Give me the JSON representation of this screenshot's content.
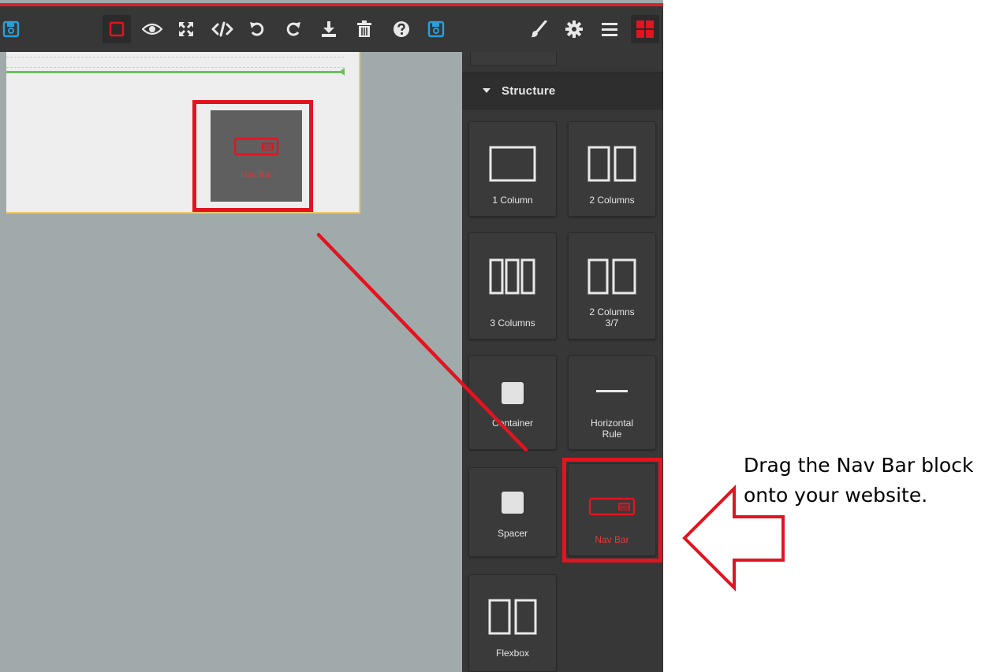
{
  "colors": {
    "canvas_bg": "#a1aaab",
    "toolbar_bg": "#373737",
    "panel_bg": "#373737",
    "accent_red": "#e2141f",
    "icon_blue": "#2a9fd8",
    "icon_white": "#e8e8e8",
    "green_line": "#6bbf5b"
  },
  "toolbar": {
    "left_icon": "save-icon",
    "icons": [
      "square-outline-icon",
      "eye-icon",
      "fullscreen-icon",
      "code-icon",
      "undo-icon",
      "redo-icon",
      "download-icon",
      "trash-icon",
      "help-icon",
      "save-icon"
    ],
    "right_icons": [
      "paintbrush-icon",
      "gear-icon",
      "menu-icon",
      "blocks-icon"
    ]
  },
  "drag_preview": {
    "label": "Nav Bar"
  },
  "panel": {
    "section_title": "Structure",
    "blocks": [
      {
        "label": "1 Column",
        "icon": "one-column-icon"
      },
      {
        "label": "2 Columns",
        "icon": "two-columns-icon"
      },
      {
        "label": "3 Columns",
        "icon": "three-columns-icon"
      },
      {
        "label": "2 Columns\n3/7",
        "icon": "two-columns-37-icon"
      },
      {
        "label": "Container",
        "icon": "container-icon"
      },
      {
        "label": "Horizontal\nRule",
        "icon": "horizontal-rule-icon"
      },
      {
        "label": "Spacer",
        "icon": "spacer-icon"
      },
      {
        "label": "Nav Bar",
        "icon": "navbar-icon"
      },
      {
        "label": "Flexbox",
        "icon": "flexbox-icon"
      }
    ]
  },
  "annotation": {
    "text": "Drag the Nav Bar block onto your website."
  }
}
